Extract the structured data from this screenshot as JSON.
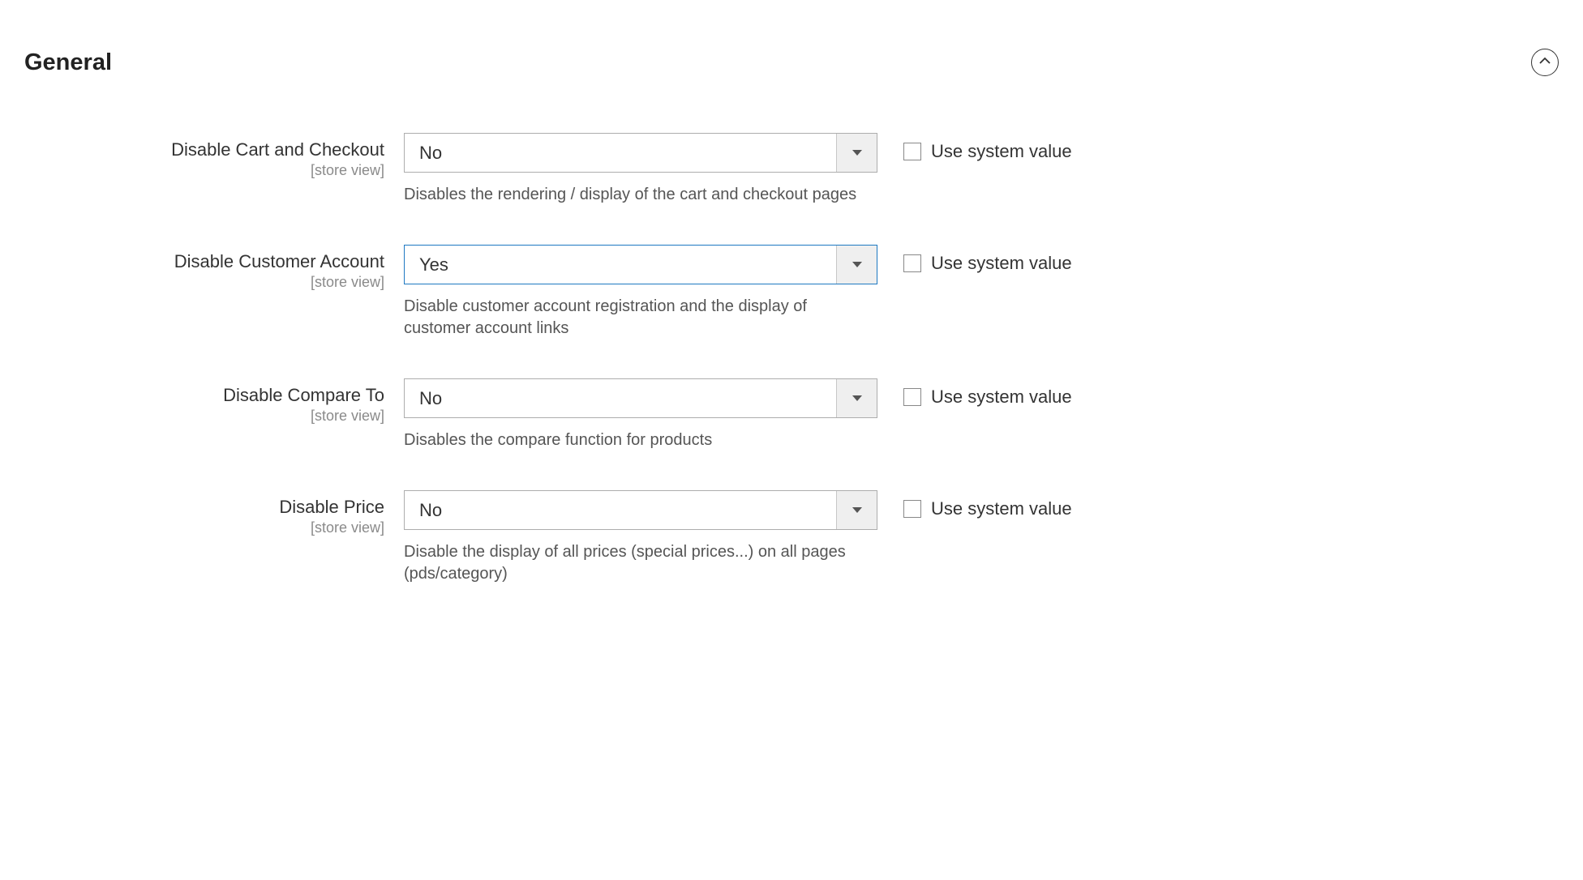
{
  "section": {
    "title": "General"
  },
  "common": {
    "scope": "[store view]",
    "use_system_label": "Use system value"
  },
  "fields": {
    "disable_cart": {
      "label": "Disable Cart and Checkout",
      "value": "No",
      "note": "Disables the rendering / display of the cart and checkout pages"
    },
    "disable_customer": {
      "label": "Disable Customer Account",
      "value": "Yes",
      "note": "Disable customer account registration and the display of customer account links"
    },
    "disable_compare": {
      "label": "Disable Compare To",
      "value": "No",
      "note": "Disables the compare function for products"
    },
    "disable_price": {
      "label": "Disable Price",
      "value": "No",
      "note": "Disable the display of all prices (special prices...) on all pages (pds/category)"
    }
  }
}
